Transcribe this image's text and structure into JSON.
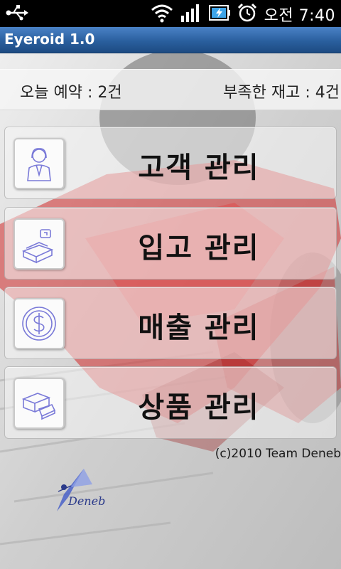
{
  "status_bar": {
    "time": "오전 7:40",
    "icons": [
      "usb-icon",
      "wifi-icon",
      "signal-icon",
      "battery-charging-icon",
      "alarm-icon"
    ]
  },
  "app": {
    "title": "Eyeroid 1.0"
  },
  "info": {
    "reservations": "오늘 예약 : 2건",
    "low_stock": "부족한 재고 : 4건"
  },
  "menu": [
    {
      "label": "고객 관리",
      "icon": "customer-icon"
    },
    {
      "label": "입고 관리",
      "icon": "receiving-icon"
    },
    {
      "label": "매출 관리",
      "icon": "sales-icon"
    },
    {
      "label": "상품 관리",
      "icon": "product-icon"
    }
  ],
  "footer": {
    "copyright": "(c)2010 Team Deneb",
    "logo_text": "Deneb"
  },
  "colors": {
    "titlebar": "#2a5f9e",
    "icon_line": "#7a7ad8",
    "car_red": "#d22a2a"
  }
}
